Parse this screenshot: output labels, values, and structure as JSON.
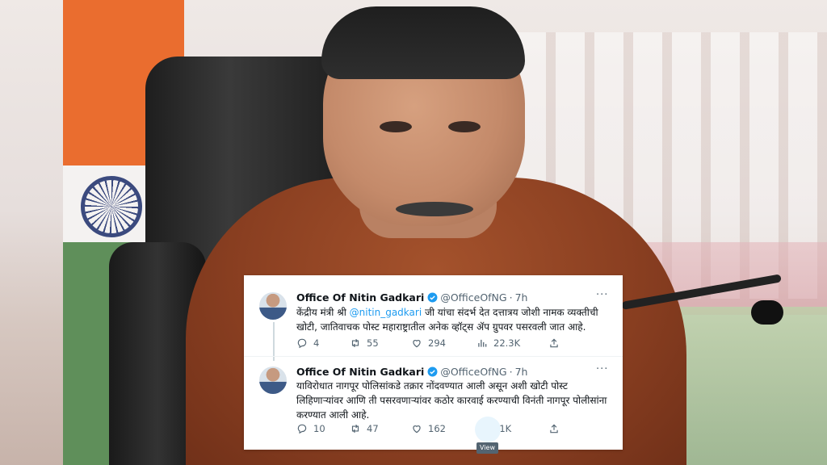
{
  "tweets": [
    {
      "name": "Office Of Nitin Gadkari",
      "handle": "@OfficeOfNG",
      "separator": "·",
      "time": "7h",
      "more": "···",
      "text_before": "केंद्रीय मंत्री श्री ",
      "mention": "@nitin_gadkari",
      "text_after": " जी यांचा संदर्भ देत दत्तात्रय जोशी नामक व्यक्तीची खोटी, जातिवाचक पोस्ट महाराष्ट्रातील अनेक व्हॉट्स ॲप ग्रुपवर पसरवली जात आहे.",
      "replies": "4",
      "retweets": "55",
      "likes": "294",
      "views": "22.3K"
    },
    {
      "name": "Office Of Nitin Gadkari",
      "handle": "@OfficeOfNG",
      "separator": "·",
      "time": "7h",
      "more": "···",
      "text": "याविरोधात नागपूर पोलिसांकडे तक्रार नोंदवण्यात आली असून अशी खोटी पोस्ट लिहिणाऱ्यांवर आणि ती पसरवणाऱ्यांवर कठोर कारवाई करण्याची विनंती नागपूर पोलीसांना करण्यात आली आहे.",
      "replies": "10",
      "retweets": "47",
      "likes": "162",
      "views": "21K"
    }
  ],
  "tooltip": "View",
  "colors": {
    "accent": "#1d9bf0",
    "text": "#0f1419",
    "muted": "#536471",
    "saffron": "#ea6d2f",
    "green": "#5f8f5a"
  },
  "icons": [
    "reply-icon",
    "retweet-icon",
    "like-icon",
    "views-icon",
    "share-icon",
    "verified-badge-icon",
    "more-icon"
  ]
}
